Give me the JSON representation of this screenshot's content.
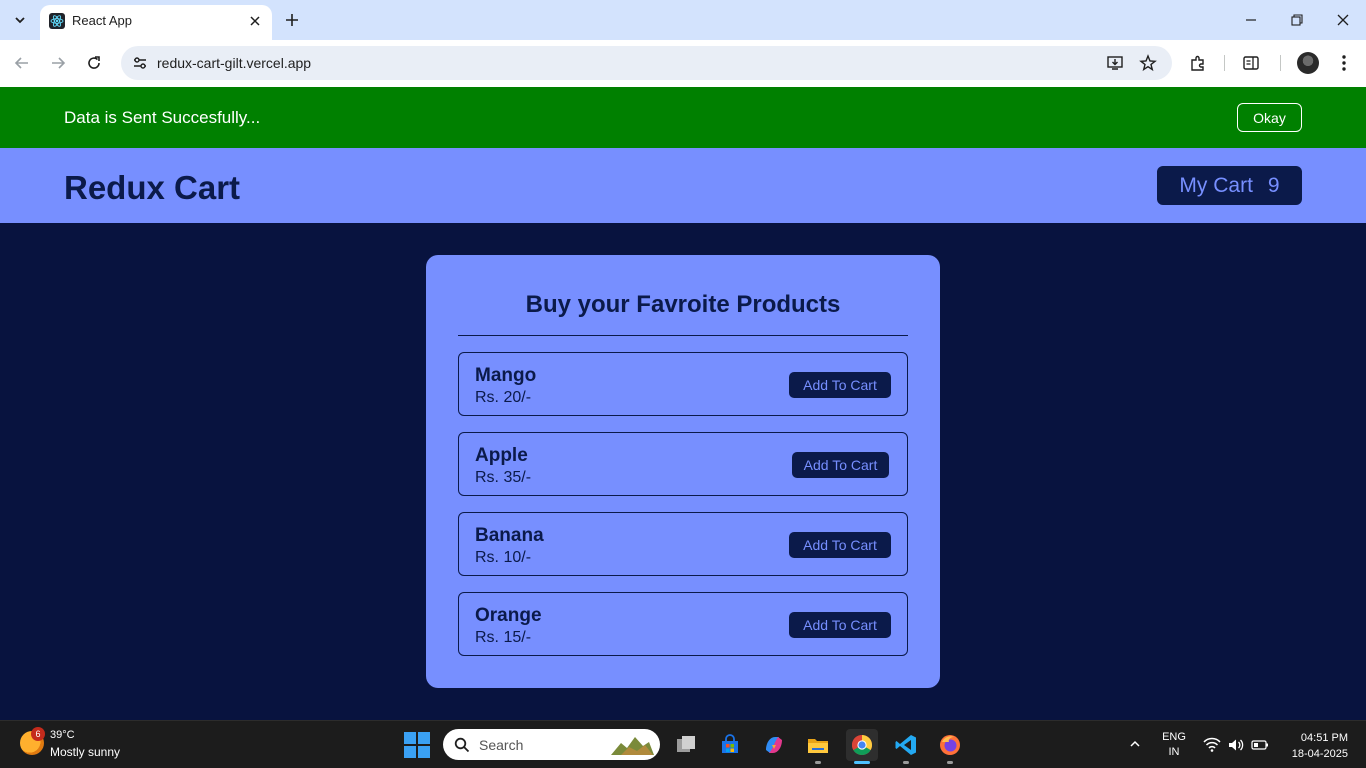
{
  "browser": {
    "tab_title": "React App",
    "url": "redux-cart-gilt.vercel.app"
  },
  "notification": {
    "message": "Data is Sent Succesfully...",
    "button_label": "Okay",
    "background_color": "#008000"
  },
  "header": {
    "brand": "Redux Cart",
    "cart_label": "My Cart",
    "cart_count": "9",
    "background_color": "#778fff"
  },
  "products_panel": {
    "title": "Buy your Favroite Products",
    "items": [
      {
        "name": "Mango",
        "price": "Rs. 20/-",
        "button_label": "Add To Cart"
      },
      {
        "name": "Apple",
        "price": "Rs. 35/-",
        "button_label": "Add To Cart"
      },
      {
        "name": "Banana",
        "price": "Rs. 10/-",
        "button_label": "Add To Cart"
      },
      {
        "name": "Orange",
        "price": "Rs. 15/-",
        "button_label": "Add To Cart"
      }
    ]
  },
  "colors": {
    "page_background": "#08133f",
    "dark_navy": "#0b1a4a",
    "accent_blue": "#778fff"
  },
  "taskbar": {
    "weather_temp": "39°C",
    "weather_condition": "Mostly sunny",
    "weather_badge": "6",
    "search_placeholder": "Search",
    "language_line1": "ENG",
    "language_line2": "IN",
    "time": "04:51 PM",
    "date": "18-04-2025"
  }
}
